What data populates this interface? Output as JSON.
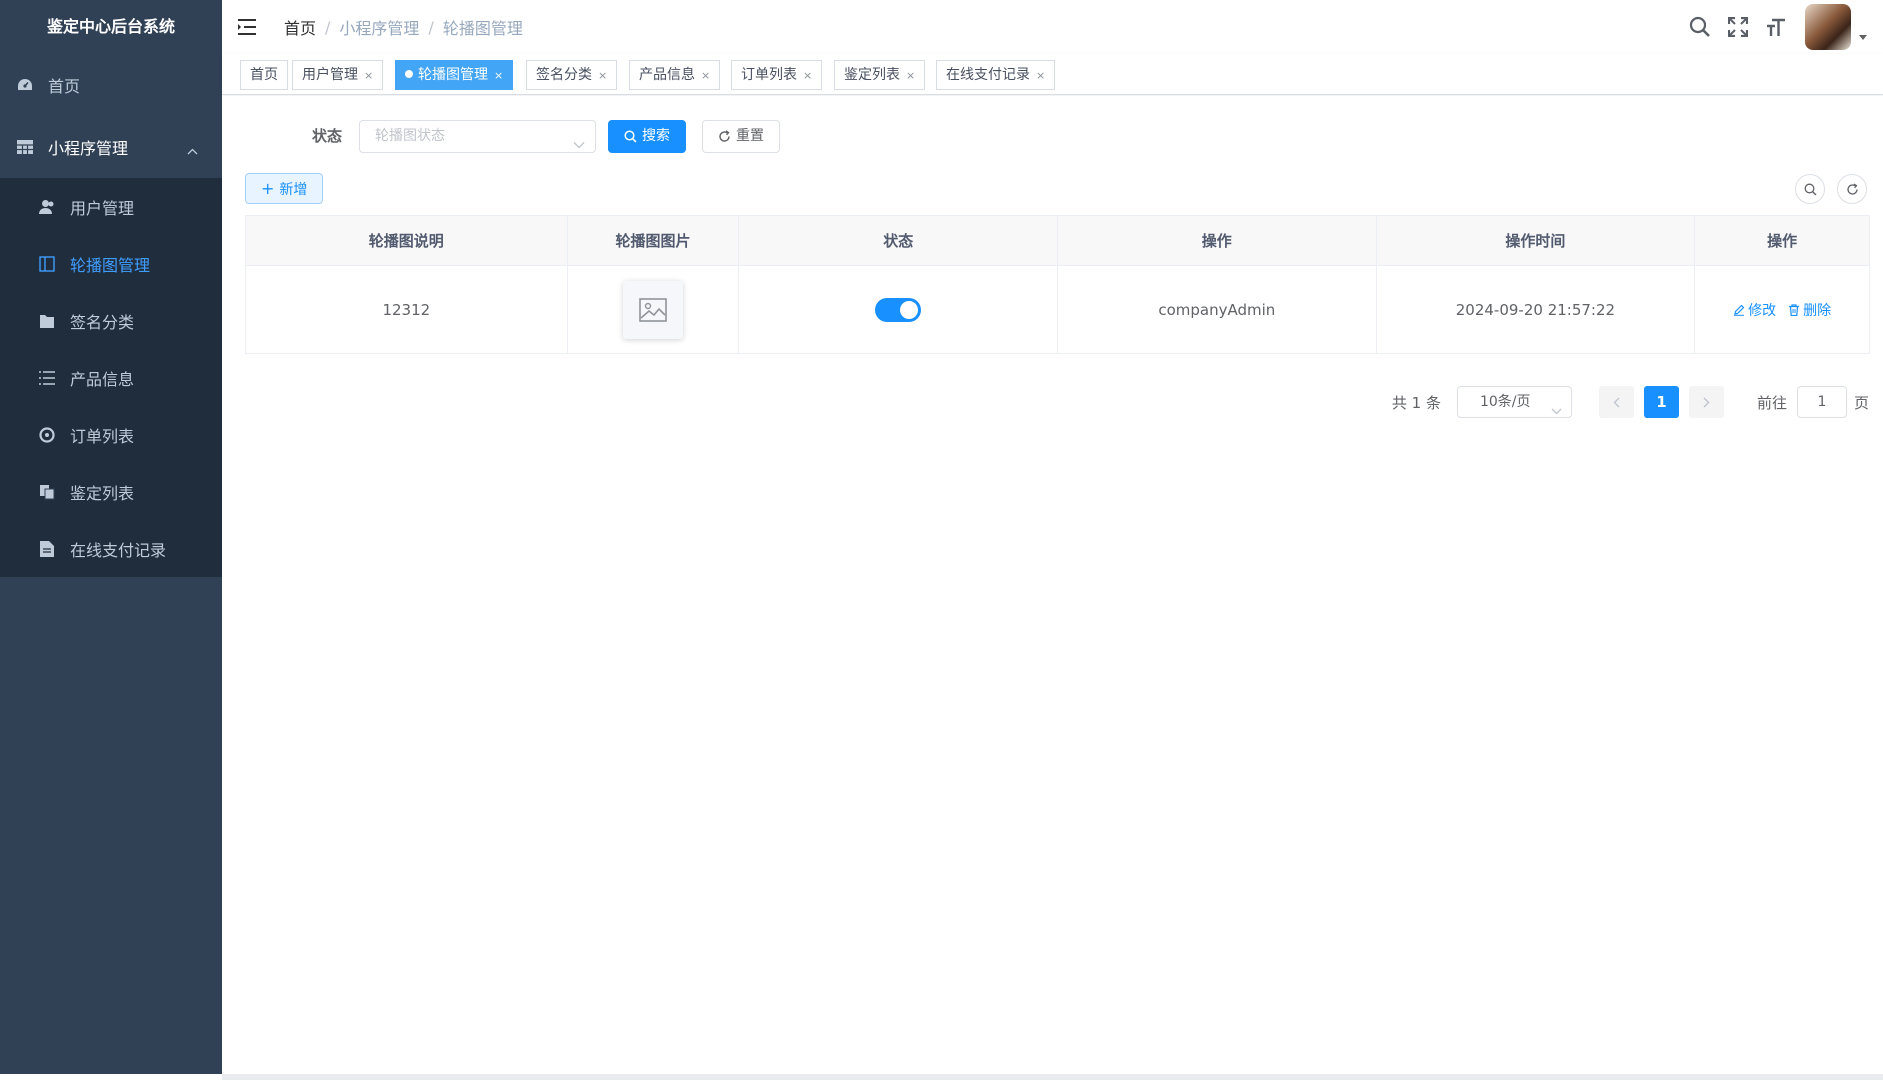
{
  "sidebar": {
    "title": "鉴定中心后台系统",
    "home": "首页",
    "group": "小程序管理",
    "items": [
      {
        "label": "用户管理",
        "icon": "user-icon"
      },
      {
        "label": "轮播图管理",
        "icon": "carousel-icon"
      },
      {
        "label": "签名分类",
        "icon": "folder-icon"
      },
      {
        "label": "产品信息",
        "icon": "list-icon"
      },
      {
        "label": "订单列表",
        "icon": "order-icon"
      },
      {
        "label": "鉴定列表",
        "icon": "copy-icon"
      },
      {
        "label": "在线支付记录",
        "icon": "document-icon"
      }
    ],
    "active_index": 1
  },
  "breadcrumb": [
    "首页",
    "小程序管理",
    "轮播图管理"
  ],
  "tags": [
    {
      "label": "首页",
      "closable": false
    },
    {
      "label": "用户管理",
      "closable": true
    },
    {
      "label": "轮播图管理",
      "closable": true,
      "active": true
    },
    {
      "label": "签名分类",
      "closable": true
    },
    {
      "label": "产品信息",
      "closable": true
    },
    {
      "label": "订单列表",
      "closable": true
    },
    {
      "label": "鉴定列表",
      "closable": true
    },
    {
      "label": "在线支付记录",
      "closable": true
    }
  ],
  "search": {
    "status_label": "状态",
    "status_placeholder": "轮播图状态",
    "search_btn": "搜索",
    "reset_btn": "重置"
  },
  "toolbar": {
    "add_btn": "新增"
  },
  "table": {
    "headers": [
      "轮播图说明",
      "轮播图图片",
      "状态",
      "操作",
      "操作时间",
      "操作"
    ],
    "rows": [
      {
        "desc": "12312",
        "status_on": true,
        "operator": "companyAdmin",
        "time": "2024-09-20 21:57:22"
      }
    ],
    "edit_label": "修改",
    "delete_label": "删除"
  },
  "pagination": {
    "total": "共 1 条",
    "page_size": "10条/页",
    "current_page": "1",
    "goto_label": "前往",
    "goto_value": "1",
    "page_suffix": "页"
  },
  "colors": {
    "sidebar_bg": "#304156",
    "submenu_bg": "#1f2d3d",
    "primary": "#1890ff",
    "active_tag": "#42a5f5"
  }
}
